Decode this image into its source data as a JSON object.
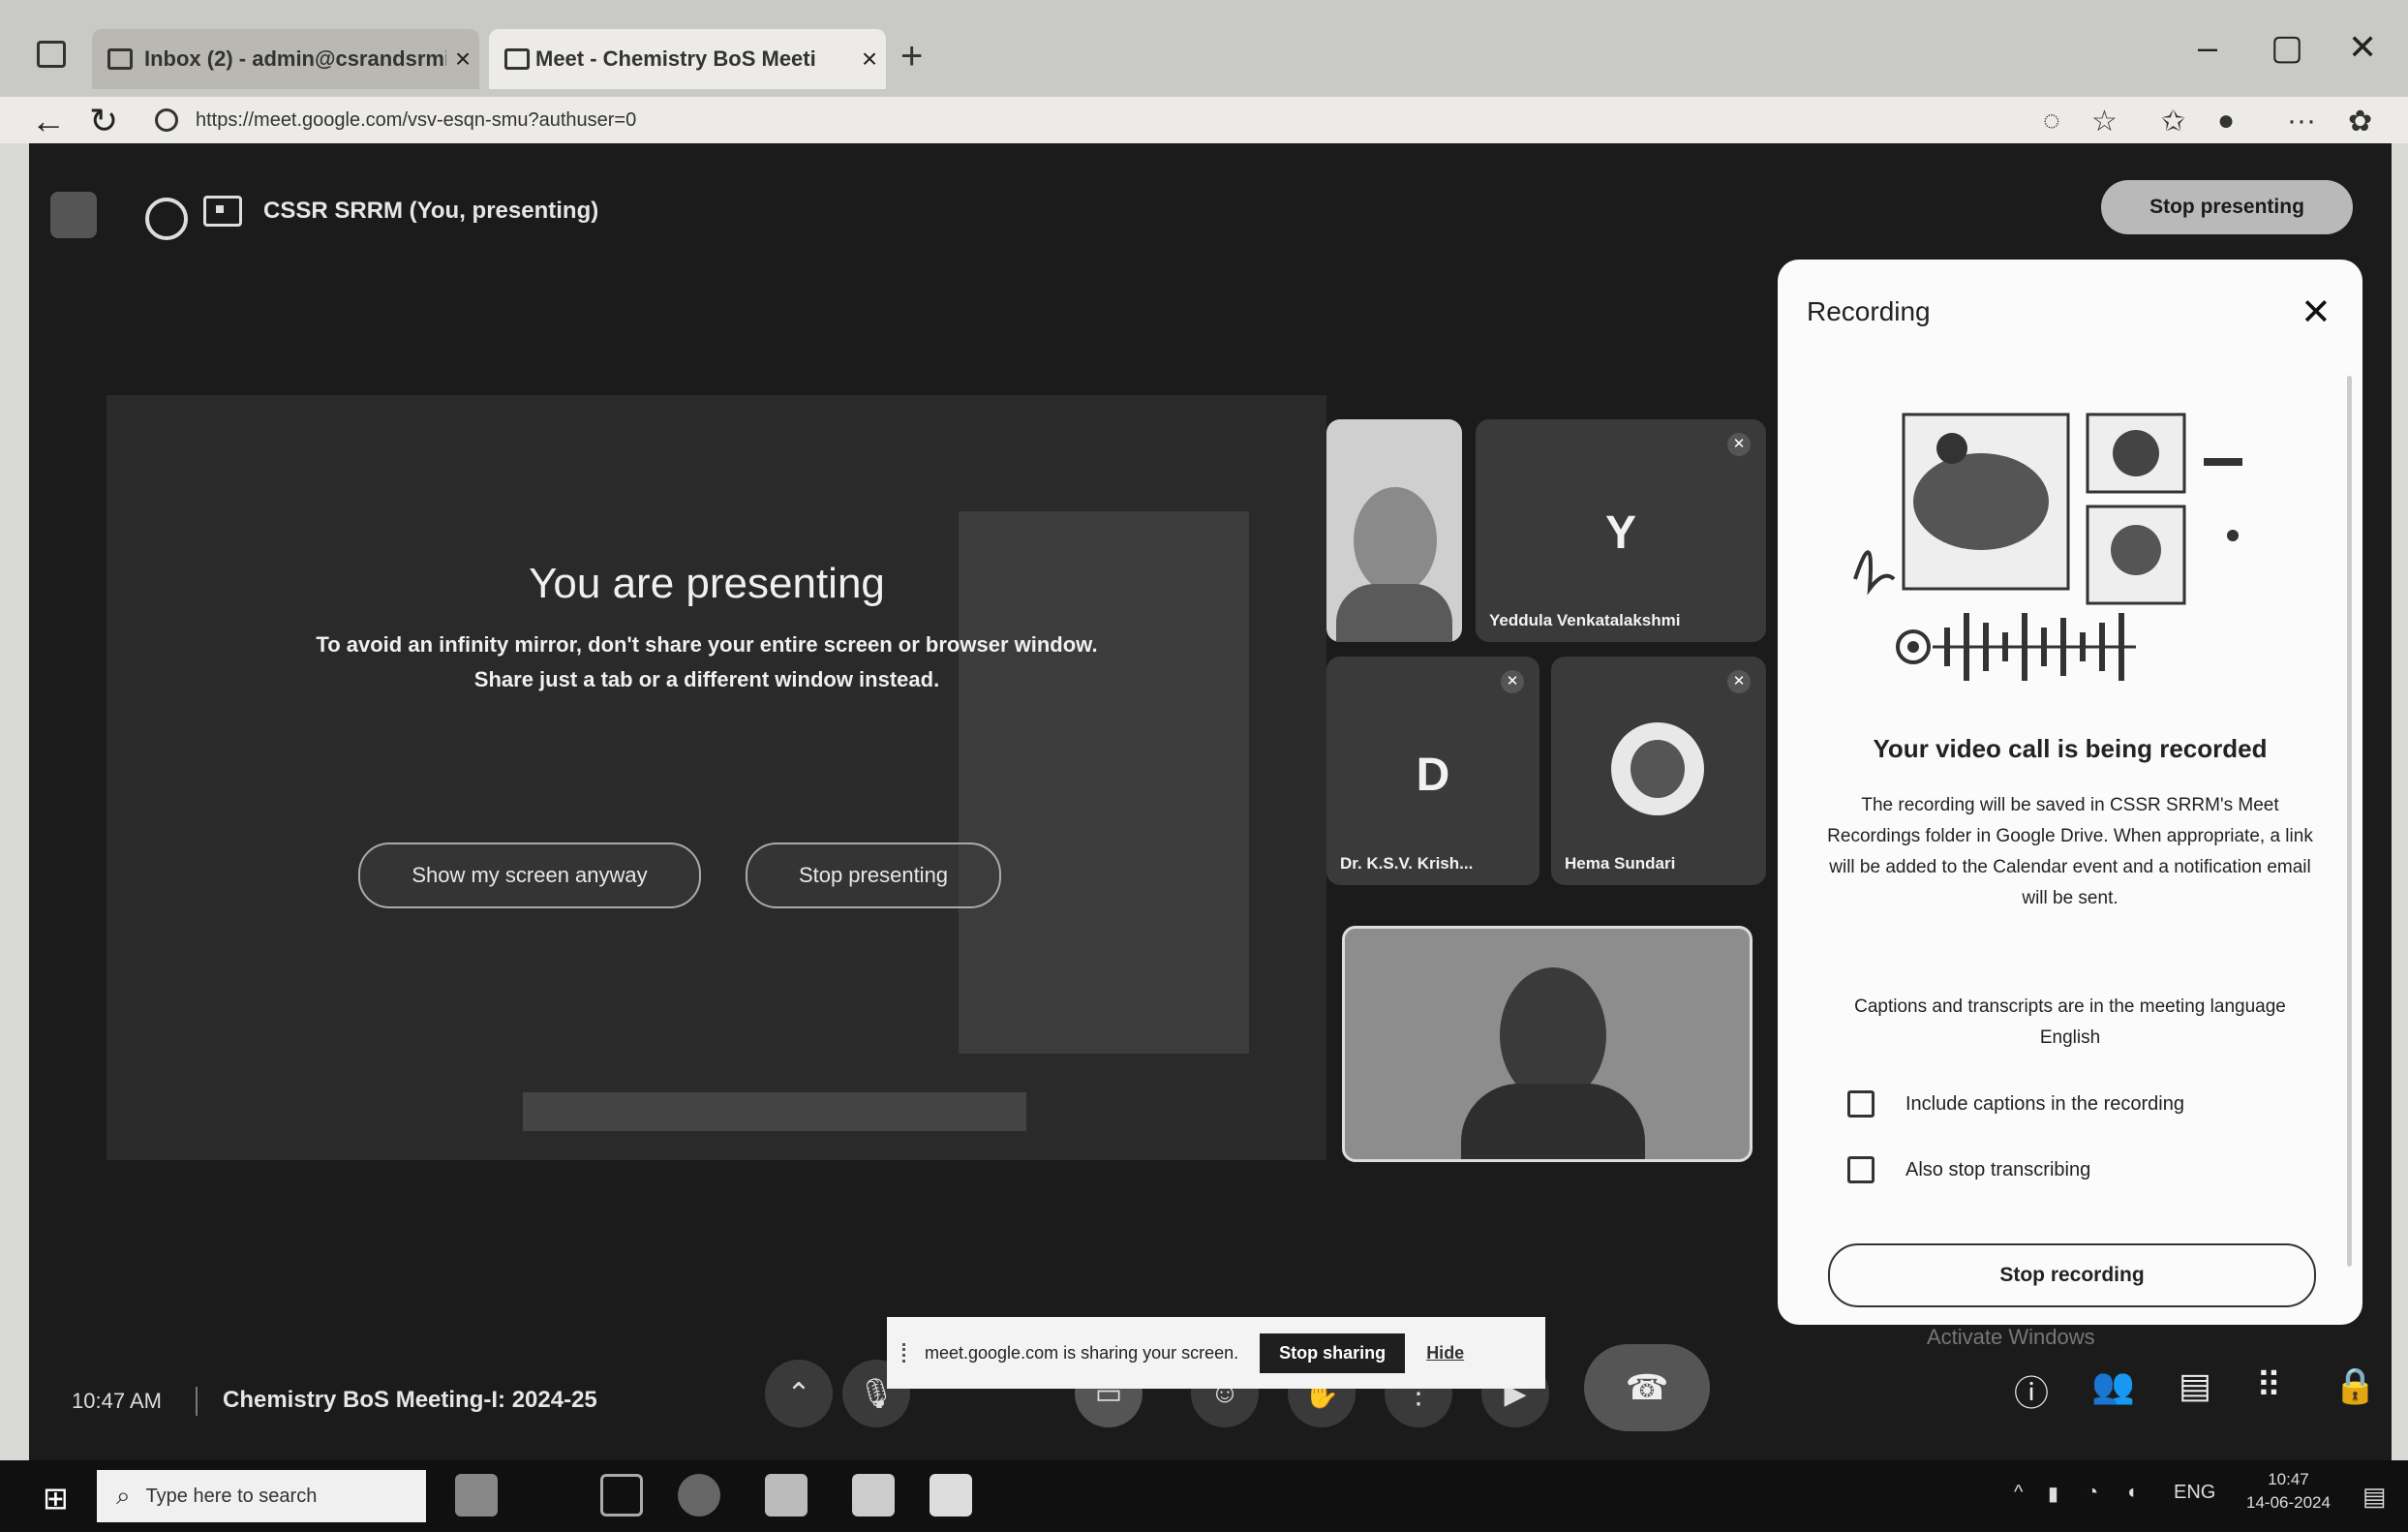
{
  "browser": {
    "tabs": [
      {
        "title": "Inbox (2) - admin@csrandsrmist",
        "active": false
      },
      {
        "title": "Meet - Chemistry BoS Meeti",
        "active": true
      }
    ],
    "url": "https://meet.google.com/vsv-esqn-smu?authuser=0",
    "window_controls": {
      "minimize": "–",
      "maximize": "▢",
      "close": "✕"
    }
  },
  "meet": {
    "presenter_label": "CSSR SRRM (You, presenting)",
    "stop_presenting_top": "Stop presenting",
    "presenting_title": "You are presenting",
    "presenting_info_line1": "To avoid an infinity mirror, don't share your entire screen or browser window.",
    "presenting_info_line2": "Share just a tab or a different window instead.",
    "show_screen_button": "Show my screen anyway",
    "stop_presenting_button": "Stop presenting",
    "participants": [
      {
        "name": "",
        "initial": ""
      },
      {
        "name": "Yeddula Venkatalakshmi",
        "initial": "Y"
      },
      {
        "name": "Dr. K.S.V. Krish...",
        "initial": "D"
      },
      {
        "name": "Hema Sundari",
        "initial": ""
      },
      {
        "name": "",
        "initial": ""
      }
    ],
    "time": "10:47 AM",
    "meeting_name": "Chemistry BoS Meeting-I: 2024-25",
    "share_banner": {
      "text": "meet.google.com is sharing your screen.",
      "stop_sharing": "Stop sharing",
      "hide": "Hide"
    },
    "activate_windows": "Activate Windows"
  },
  "recording_panel": {
    "title": "Recording",
    "heading": "Your video call is being recorded",
    "body": "The recording will be saved in CSSR SRRM's Meet Recordings folder in Google Drive. When appropriate, a link will be added to the Calendar event and a notification email will be sent.",
    "captions_info": "Captions and transcripts are in the meeting language English",
    "checkbox_captions": "Include captions in the recording",
    "checkbox_transcribing": "Also stop transcribing",
    "stop_recording": "Stop recording"
  },
  "taskbar": {
    "search_placeholder": "Type here to search",
    "clock_time": "10:47",
    "clock_date": "14-06-2024",
    "lang": "ENG"
  },
  "colors": {
    "meet_bg": "#1b1b1b",
    "panel_bg": "#fbfbfb",
    "taskbar_bg": "#101010"
  }
}
